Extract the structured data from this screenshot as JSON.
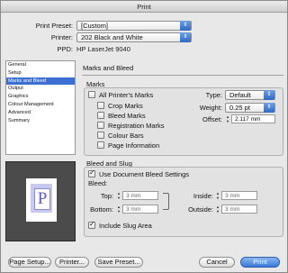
{
  "window": {
    "title": "Print"
  },
  "header": {
    "preset_label": "Print Preset:",
    "preset_value": "[Custom]",
    "printer_label": "Printer:",
    "printer_value": "202 Black and White",
    "ppd_label": "PPD:",
    "ppd_value": "HP LaserJet 9040"
  },
  "sidebar": {
    "items": [
      {
        "label": "General"
      },
      {
        "label": "Setup"
      },
      {
        "label": "Marks and Bleed"
      },
      {
        "label": "Output"
      },
      {
        "label": "Graphics"
      },
      {
        "label": "Colour Management"
      },
      {
        "label": "Advanced"
      },
      {
        "label": "Summary"
      }
    ],
    "selected_index": 2
  },
  "main": {
    "section_title": "Marks and Bleed",
    "marks": {
      "title": "Marks",
      "all_printers_marks": "All Printer's Marks",
      "crop_marks": "Crop Marks",
      "bleed_marks": "Bleed Marks",
      "registration_marks": "Registration Marks",
      "colour_bars": "Colour Bars",
      "page_information": "Page Information",
      "type_label": "Type:",
      "type_value": "Default",
      "weight_label": "Weight:",
      "weight_value": "0.25 pt",
      "offset_label": "Offset:",
      "offset_value": "2.117 mm"
    },
    "bleed": {
      "title": "Bleed and Slug",
      "use_document_bleed": "Use Document Bleed Settings",
      "bleed_label": "Bleed:",
      "top_label": "Top:",
      "top_value": "3 mm",
      "bottom_label": "Bottom:",
      "bottom_value": "3 mm",
      "inside_label": "Inside:",
      "inside_value": "3 mm",
      "outside_label": "Outside:",
      "outside_value": "3 mm",
      "include_slug": "Include Slug Area"
    }
  },
  "preview": {
    "letter": "P"
  },
  "footer": {
    "page_setup": "Page Setup...",
    "printer": "Printer...",
    "save_preset": "Save Preset...",
    "cancel": "Cancel",
    "print": "Print"
  },
  "colors": {
    "accent": "#3d6fd2",
    "preview_bg": "#4b4b4b",
    "preview_letter": "#5a5ac2"
  }
}
